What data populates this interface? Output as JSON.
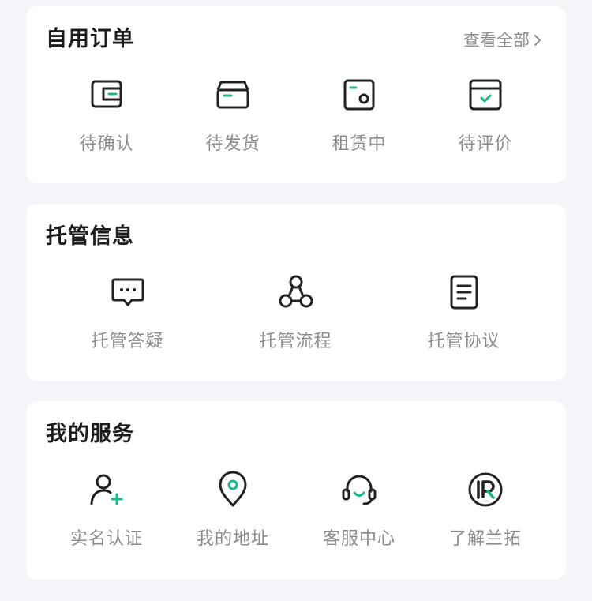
{
  "orders": {
    "title": "自用订单",
    "view_all": "查看全部",
    "items": [
      {
        "label": "待确认",
        "icon": "wallet-icon"
      },
      {
        "label": "待发货",
        "icon": "box-icon"
      },
      {
        "label": "租赁中",
        "icon": "lease-icon"
      },
      {
        "label": "待评价",
        "icon": "review-icon"
      }
    ]
  },
  "hosting": {
    "title": "托管信息",
    "items": [
      {
        "label": "托管答疑",
        "icon": "chat-bubble-icon"
      },
      {
        "label": "托管流程",
        "icon": "flow-nodes-icon"
      },
      {
        "label": "托管协议",
        "icon": "document-icon"
      }
    ]
  },
  "services": {
    "title": "我的服务",
    "items": [
      {
        "label": "实名认证",
        "icon": "user-add-icon"
      },
      {
        "label": "我的地址",
        "icon": "location-pin-icon"
      },
      {
        "label": "客服中心",
        "icon": "headset-icon"
      },
      {
        "label": "了解兰拓",
        "icon": "brand-logo-icon"
      }
    ]
  },
  "colors": {
    "accent": "#1bb888",
    "icon_stroke": "#222222",
    "label": "#8c8c8c",
    "background": "#f4f5f9"
  }
}
